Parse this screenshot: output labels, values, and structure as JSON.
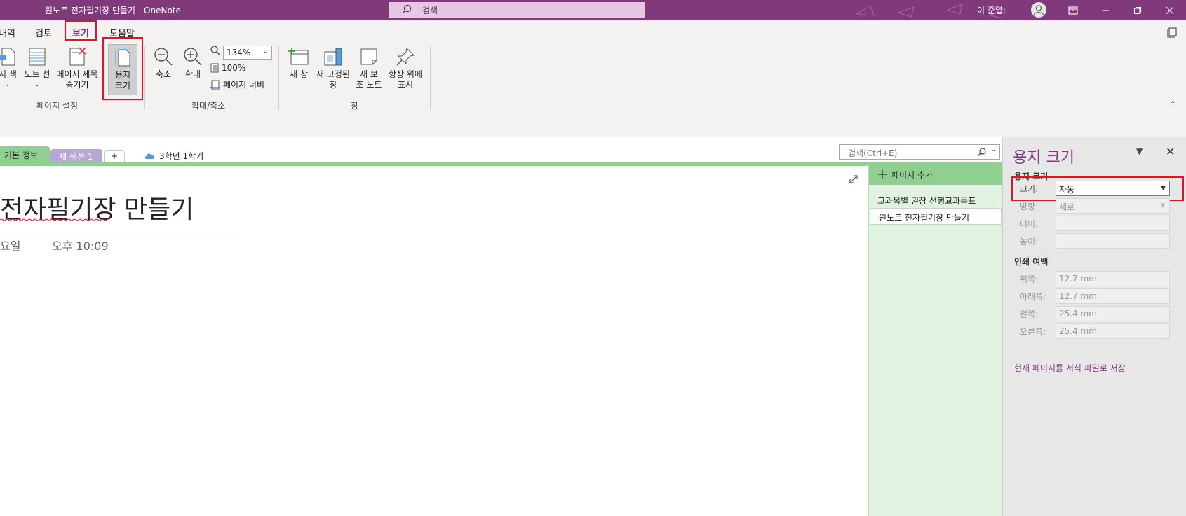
{
  "app": {
    "window_title": "원노트 전자필기장 만들기  -  OneNote",
    "search_placeholder": "검색",
    "user_name": "이 준열"
  },
  "ribbon": {
    "tabs": [
      {
        "label": "내역"
      },
      {
        "label": "검토"
      },
      {
        "label": "보기",
        "active": true
      },
      {
        "label": "도움말"
      }
    ],
    "page_setup": {
      "group_label": "페이지 설정",
      "buttons": {
        "page_color": "지 색",
        "rule_lines": "노트 선",
        "hide_title_line1": "페이지 제목",
        "hide_title_line2": "숨기기",
        "paper_size_line1": "용지",
        "paper_size_line2": "크기"
      }
    },
    "zoom": {
      "group_label": "확대/축소",
      "zoom_out": "축소",
      "zoom_in": "확대",
      "zoom_value": "134%",
      "hundred": "100%",
      "page_width": "페이지 너비"
    },
    "window": {
      "group_label": "창",
      "new_window": "새 창",
      "new_docked_line1": "새 고정된",
      "new_docked_line2": "창",
      "new_side_note_line1": "새 보",
      "new_side_note_line2": "조 노트",
      "always_on_top_line1": "항상 위에",
      "always_on_top_line2": "표시"
    }
  },
  "sections": {
    "tabs": [
      {
        "label": "기본 정보"
      },
      {
        "label": "새 섹션 1"
      },
      {
        "label": "+"
      }
    ],
    "notebook_name": "3학년 1학기",
    "search_placeholder": "검색(Ctrl+E)"
  },
  "page": {
    "title": "전자필기장 만들기",
    "date": "요일",
    "time": "오후 10:09"
  },
  "page_list": {
    "add_page": "페이지 추가",
    "items": [
      {
        "label": "교과목별 권장 선행교과목표"
      },
      {
        "label": "원노트 전자필기장 만들기",
        "active": true
      }
    ]
  },
  "paper_pane": {
    "title": "용지 크기",
    "section_paper": "용지 크기",
    "size_label": "크기:",
    "size_value": "자동",
    "orientation_label": "방향:",
    "orientation_value": "세로",
    "width_label": "너비:",
    "height_label": "높이:",
    "section_margins": "인쇄 여백",
    "top_label": "위쪽:",
    "top_value": "12.7 mm",
    "bottom_label": "아래쪽:",
    "bottom_value": "12.7 mm",
    "left_label": "왼쪽:",
    "left_value": "25.4 mm",
    "right_label": "오른쪽:",
    "right_value": "25.4 mm",
    "save_template_link": "현재 페이지를 서식 파일로 저장"
  },
  "colors": {
    "accent": "#80397b",
    "highlight": "#e81123",
    "section_green": "#8fcf8f"
  }
}
